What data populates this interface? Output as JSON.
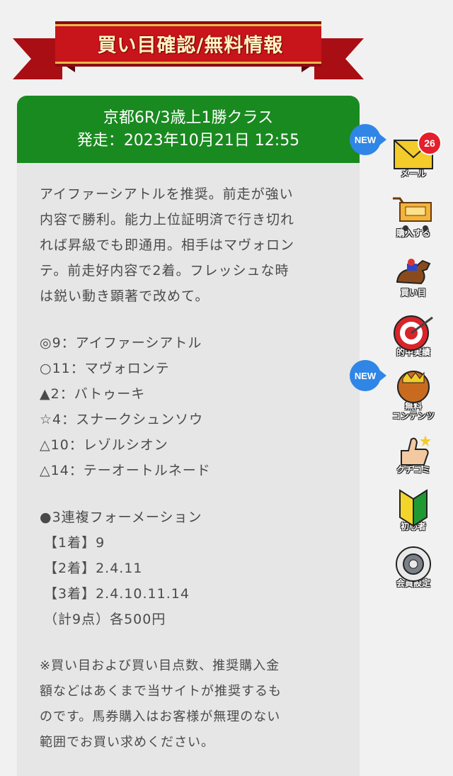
{
  "banner": {
    "title": "買い目確認/無料情報"
  },
  "race": {
    "title": "京都6R/3歳上1勝クラス",
    "start": "発走：2023年10月21日 12:55"
  },
  "comment": [
    "アイファーシアトルを推奨。前走が強い",
    "内容で勝利。能力上位証明済で行き切れ",
    "れば昇級でも即通用。相手はマヴォロン",
    "テ。前走好内容で2着。フレッシュな時",
    "は鋭い動き顕著で改めて。"
  ],
  "picks": [
    "◎9：アイファーシアトル",
    "○11：マヴォロンテ",
    "▲2：バトゥーキ",
    "☆4：スナークシュンソウ",
    "△10：レゾルシオン",
    "△14：テーオートルネード"
  ],
  "formation": {
    "title": "●3連複フォーメーション",
    "rows": [
      "【1着】9",
      "【2着】2.4.11",
      "【3着】2.4.10.11.14"
    ],
    "total": "（計9点）各500円"
  },
  "note": [
    "※買い目および買い目点数、推奨購入金",
    "額などはあくまで当サイトが推奨するも",
    "のです。馬券購入はお客様が無理のない",
    "範囲でお買い求めください。"
  ],
  "side_menu": {
    "new_label": "NEW",
    "mail_count": "26",
    "items": [
      {
        "label": "メール",
        "icon": "mail-icon"
      },
      {
        "label": "購入する",
        "icon": "cart-icon"
      },
      {
        "label": "買い目",
        "icon": "horse-icon"
      },
      {
        "label": "的中実績",
        "icon": "target-icon"
      },
      {
        "label_line1": "無料",
        "label_line2": "コンテンツ",
        "icon": "crown-icon"
      },
      {
        "label": "クチコミ",
        "icon": "thumbs-up-icon"
      },
      {
        "label": "初心者",
        "icon": "beginner-mark-icon"
      },
      {
        "label": "会員設定",
        "icon": "settings-icon"
      }
    ]
  },
  "colors": {
    "header_green": "#198a1f",
    "ribbon_red": "#c8141b",
    "new_blue": "#2f86e6",
    "badge_red": "#e3202b"
  }
}
